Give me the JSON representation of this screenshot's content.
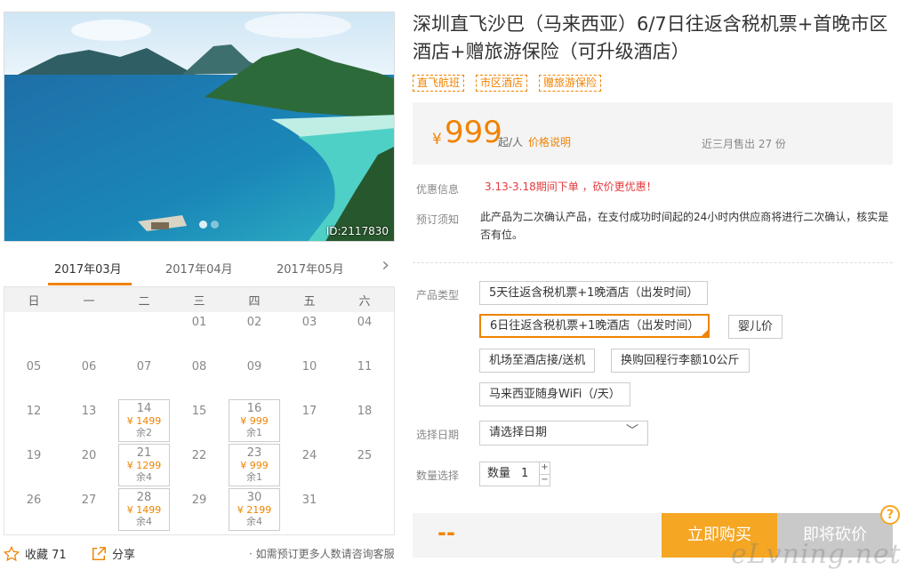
{
  "product": {
    "title": "深圳直飞沙巴（马来西亚）6/7日往返含税机票+首晚市区酒店+赠旅游保险（可升级酒店）",
    "tags": [
      "直飞航班",
      "市区酒店",
      "赠旅游保险"
    ],
    "image_id": "ID:2117830"
  },
  "price": {
    "currency": "¥",
    "value": "999",
    "unit": "起/人",
    "note": "价格说明",
    "sold": "近三月售出 27 份"
  },
  "info": {
    "promo_label": "优惠信息",
    "promo_text": "3.13-3.18期间下单 ，砍价更优惠！",
    "notice_label": "预订须知",
    "notice_text": "此产品为二次确认产品，在支付成功时间起的24小时内供应商将进行二次确认，核实是否有位。"
  },
  "options": {
    "type_label": "产品类型",
    "items": [
      "5天往返含税机票+1晚酒店（出发时间）",
      "6日往返含税机票+1晚酒店（出发时间）",
      "婴儿价",
      "机场至酒店接/送机",
      "换购回程行李额10公斤",
      "马来西亚随身WiFi（/天）"
    ],
    "selected_index": 1,
    "date_label": "选择日期",
    "date_placeholder": "请选择日期",
    "qty_label": "数量选择",
    "qty_text": "数量",
    "qty_value": "1"
  },
  "buy": {
    "total": "--",
    "buy_label": "立即购买",
    "bargain_label": "即将砍价",
    "help": "?"
  },
  "calendar": {
    "months": [
      "2017年03月",
      "2017年04月",
      "2017年05月"
    ],
    "active_month": 0,
    "weekdays": [
      "日",
      "一",
      "二",
      "三",
      "四",
      "五",
      "六"
    ],
    "days": [
      {
        "d": "01",
        "col": 3,
        "row": 0
      },
      {
        "d": "02",
        "col": 4,
        "row": 0
      },
      {
        "d": "03",
        "col": 5,
        "row": 0
      },
      {
        "d": "04",
        "col": 6,
        "row": 0
      },
      {
        "d": "05",
        "col": 0,
        "row": 1
      },
      {
        "d": "06",
        "col": 1,
        "row": 1
      },
      {
        "d": "07",
        "col": 2,
        "row": 1
      },
      {
        "d": "08",
        "col": 3,
        "row": 1
      },
      {
        "d": "09",
        "col": 4,
        "row": 1
      },
      {
        "d": "10",
        "col": 5,
        "row": 1
      },
      {
        "d": "11",
        "col": 6,
        "row": 1
      },
      {
        "d": "12",
        "col": 0,
        "row": 2
      },
      {
        "d": "13",
        "col": 1,
        "row": 2
      },
      {
        "d": "14",
        "col": 2,
        "row": 2,
        "price": "¥ 1499",
        "remain": "余2"
      },
      {
        "d": "15",
        "col": 3,
        "row": 2
      },
      {
        "d": "16",
        "col": 4,
        "row": 2,
        "price": "¥ 999",
        "remain": "余1"
      },
      {
        "d": "17",
        "col": 5,
        "row": 2
      },
      {
        "d": "18",
        "col": 6,
        "row": 2
      },
      {
        "d": "19",
        "col": 0,
        "row": 3
      },
      {
        "d": "20",
        "col": 1,
        "row": 3
      },
      {
        "d": "21",
        "col": 2,
        "row": 3,
        "price": "¥ 1299",
        "remain": "余4"
      },
      {
        "d": "22",
        "col": 3,
        "row": 3
      },
      {
        "d": "23",
        "col": 4,
        "row": 3,
        "price": "¥ 999",
        "remain": "余1"
      },
      {
        "d": "24",
        "col": 5,
        "row": 3
      },
      {
        "d": "25",
        "col": 6,
        "row": 3
      },
      {
        "d": "26",
        "col": 0,
        "row": 4
      },
      {
        "d": "27",
        "col": 1,
        "row": 4
      },
      {
        "d": "28",
        "col": 2,
        "row": 4,
        "price": "¥ 1499",
        "remain": "余4"
      },
      {
        "d": "29",
        "col": 3,
        "row": 4
      },
      {
        "d": "30",
        "col": 4,
        "row": 4,
        "price": "¥ 2199",
        "remain": "余4"
      },
      {
        "d": "31",
        "col": 5,
        "row": 4
      }
    ]
  },
  "footer": {
    "favorite": "收藏 71",
    "share": "分享",
    "note": "· 如需预订更多人数请咨询客服"
  },
  "watermark": "eLvning.net",
  "colors": {
    "accent": "#f08300",
    "buy_button": "#f5a623",
    "promo": "#e4393c"
  }
}
